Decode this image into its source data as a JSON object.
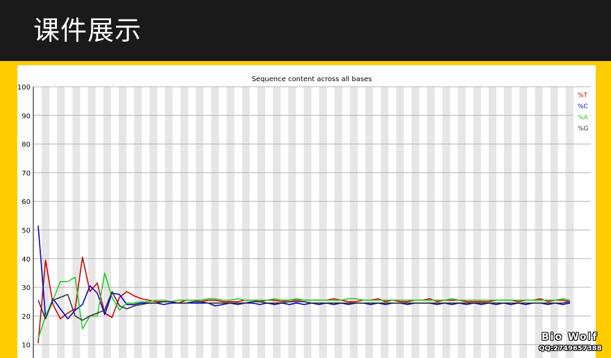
{
  "header": {
    "title": "课件展示"
  },
  "watermark": {
    "name": "Bio Wolf",
    "contact": "QQ:2749657388"
  },
  "colors": {
    "header_bg": "#1a1a1a",
    "frame": "#ffcc00",
    "T": "#cc0000",
    "C": "#0000cc",
    "A": "#22cc22",
    "G": "#333333"
  },
  "chart_data": {
    "type": "line",
    "title": "Sequence content across all bases",
    "xlabel": "",
    "ylabel": "",
    "ylim": [
      0,
      100
    ],
    "yticks": [
      "100",
      "90",
      "80",
      "70",
      "60",
      "50",
      "40",
      "30",
      "20",
      "10"
    ],
    "grid": true,
    "legend": "top-right",
    "series": [
      {
        "name": "%T",
        "color": "#cc0000",
        "values": [
          10.5,
          39.5,
          24,
          19,
          21,
          22.5,
          40.5,
          28.5,
          31.5,
          21,
          19.5,
          26.5,
          28.5,
          27,
          26,
          25.5,
          25,
          25,
          25,
          24.5,
          25.5,
          25.5,
          25,
          25.5,
          25.5,
          25,
          25,
          25,
          25.5,
          25.5,
          25,
          25.5,
          25.5,
          25,
          25.5,
          25.5,
          25.5,
          25.5,
          25.5,
          25.5,
          26,
          25.5,
          25,
          25,
          25.5,
          25.5,
          26,
          25,
          25.5,
          25,
          25,
          25.5,
          25.5,
          26,
          25,
          25.5,
          25.5,
          25.5,
          25,
          25,
          25,
          25,
          25.5,
          25.5,
          25.5,
          25,
          25.5,
          25.5,
          26,
          25,
          25.5,
          25.5,
          25
        ]
      },
      {
        "name": "%C",
        "color": "#0000cc",
        "values": [
          51.5,
          19.5,
          26,
          22.5,
          19,
          22,
          24,
          30.5,
          28,
          20.5,
          28,
          27.5,
          24,
          24,
          24.5,
          24.5,
          24.5,
          24,
          24.5,
          24.5,
          24.5,
          24.5,
          24.5,
          24.5,
          23.5,
          24,
          24.5,
          24,
          24.5,
          24.5,
          24,
          24.5,
          24,
          24.5,
          24,
          24.5,
          24,
          24.5,
          24,
          24.5,
          24,
          24.5,
          24,
          24.5,
          24.5,
          24,
          24.5,
          24,
          24.5,
          24.5,
          24,
          24.5,
          24.5,
          24.5,
          24,
          24.5,
          24,
          24.5,
          24,
          24.5,
          24,
          24.5,
          24,
          24.5,
          24,
          24.5,
          24,
          24.5,
          24.5,
          24,
          24.5,
          24,
          24.5
        ]
      },
      {
        "name": "%A",
        "color": "#22cc22",
        "values": [
          12,
          20,
          25.5,
          32,
          32,
          33.5,
          15.5,
          20,
          20,
          35,
          26.5,
          22,
          24.5,
          24.5,
          25,
          25,
          25.5,
          25.5,
          25,
          25.5,
          25.5,
          25.5,
          25.5,
          26,
          26,
          25.5,
          25.5,
          26,
          25.5,
          25.5,
          25.5,
          25.5,
          26,
          25.5,
          25.5,
          26,
          25.5,
          25.5,
          25.5,
          25.5,
          25.5,
          25.5,
          26,
          26,
          25.5,
          25.5,
          25.5,
          25.5,
          25.5,
          25.5,
          25.5,
          25.5,
          25.5,
          25.5,
          25.5,
          25.5,
          26,
          25.5,
          25.5,
          25.5,
          25.5,
          25.5,
          25.5,
          25.5,
          25.5,
          25.5,
          25.5,
          25.5,
          25.5,
          25.5,
          25.5,
          26,
          25.5
        ]
      },
      {
        "name": "%G",
        "color": "#333333",
        "values": [
          25.5,
          19,
          25.5,
          26.5,
          27.5,
          20,
          18.5,
          20,
          21,
          22,
          28.5,
          23.5,
          22.5,
          23.5,
          24,
          24.5,
          24.5,
          25,
          25,
          24.5,
          24.5,
          25,
          25,
          24.5,
          24.5,
          24.5,
          24.5,
          24.5,
          24.5,
          25,
          25,
          24.5,
          24.5,
          24.5,
          25,
          25,
          25,
          24.5,
          24.5,
          24.5,
          24.5,
          24.5,
          24.5,
          24.5,
          24.5,
          24.5,
          24.5,
          24.5,
          24.5,
          24.5,
          24.5,
          24.5,
          24.5,
          24.5,
          24.5,
          24.5,
          24.5,
          24.5,
          24.5,
          24.5,
          24.5,
          24.5,
          24.5,
          24.5,
          24.5,
          24.5,
          24.5,
          24.5,
          24.5,
          24.5,
          24.5,
          24.5,
          25
        ]
      }
    ]
  }
}
